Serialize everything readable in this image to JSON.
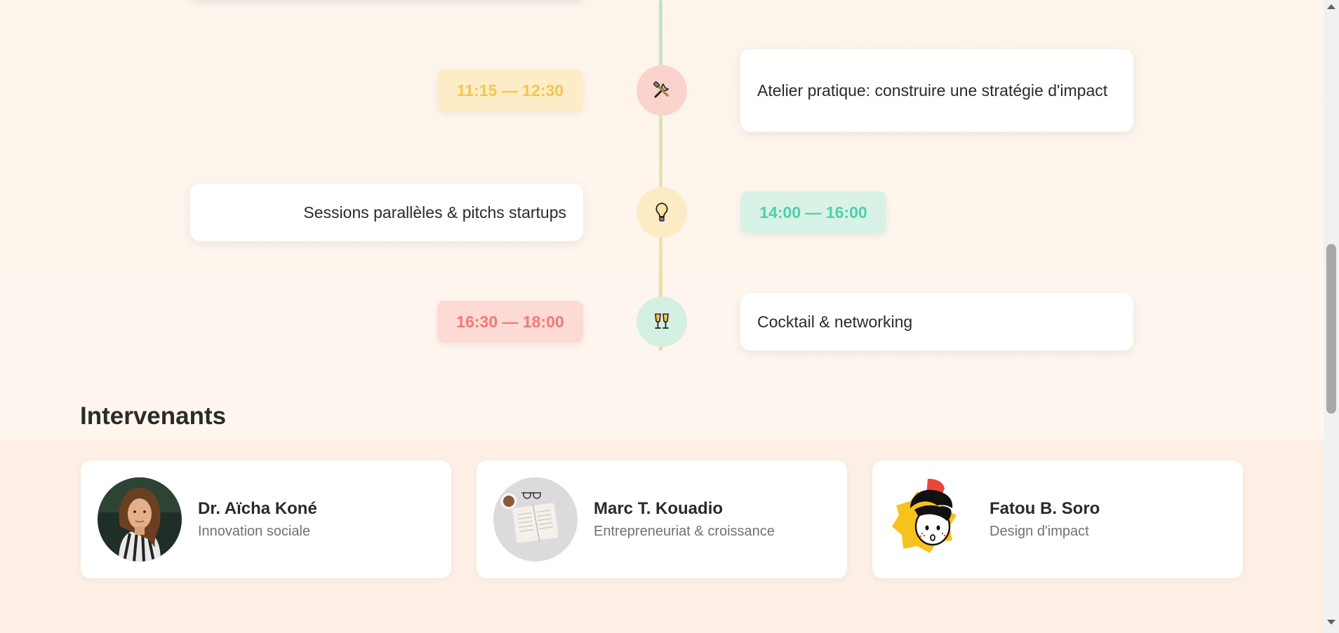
{
  "schedule": [
    {
      "time": "11:15 — 12:30",
      "title": "Atelier pratique: construire une stratégie d'impact",
      "icon": "tools-icon",
      "time_color": "#f5c64a",
      "time_bg": "#fdecc8",
      "dot_bg": "#fbd3cd"
    },
    {
      "time": "14:00 — 16:00",
      "title": "Sessions parallèles & pitchs startups",
      "icon": "lightbulb-icon",
      "time_color": "#4fcfb0",
      "time_bg": "#d8f2e6",
      "dot_bg": "#fdebc6"
    },
    {
      "time": "16:30 — 18:00",
      "title": "Cocktail & networking",
      "icon": "champagne-icon",
      "time_color": "#ef7a77",
      "time_bg": "#fddad3",
      "dot_bg": "#d4f0e2"
    }
  ],
  "speakers_section": {
    "title": "Intervenants"
  },
  "speakers": [
    {
      "name": "Dr. Aïcha Koné",
      "role": "Innovation sociale",
      "avatar": "portrait-photo"
    },
    {
      "name": "Marc T. Kouadio",
      "role": "Entrepreneuriat & croissance",
      "avatar": "book-coffee-photo"
    },
    {
      "name": "Fatou B. Soro",
      "role": "Design d'impact",
      "avatar": "cartoon-character-avatar"
    }
  ]
}
